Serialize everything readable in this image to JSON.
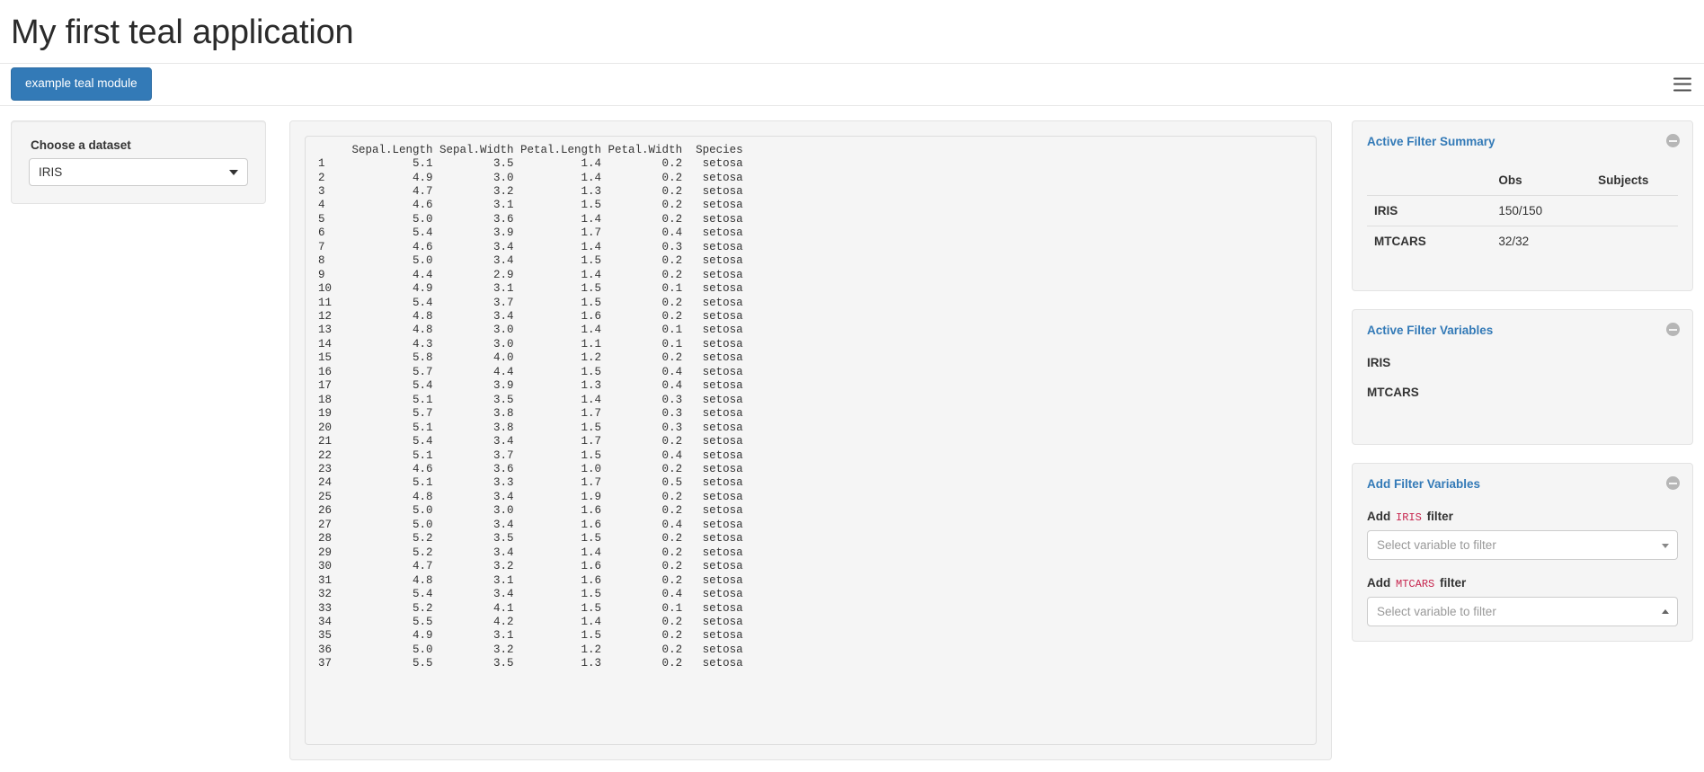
{
  "header": {
    "title": "My first teal application",
    "tab_label": "example teal module",
    "menu_icon": "hamburger-icon"
  },
  "sidebar": {
    "dataset_label": "Choose a dataset",
    "dataset_value": "IRIS",
    "caret_icon": "chevron-down-icon"
  },
  "table": {
    "columns": [
      "",
      "Sepal.Length",
      "Sepal.Width",
      "Petal.Length",
      "Petal.Width",
      "Species"
    ],
    "rows": [
      [
        "1",
        "5.1",
        "3.5",
        "1.4",
        "0.2",
        "setosa"
      ],
      [
        "2",
        "4.9",
        "3.0",
        "1.4",
        "0.2",
        "setosa"
      ],
      [
        "3",
        "4.7",
        "3.2",
        "1.3",
        "0.2",
        "setosa"
      ],
      [
        "4",
        "4.6",
        "3.1",
        "1.5",
        "0.2",
        "setosa"
      ],
      [
        "5",
        "5.0",
        "3.6",
        "1.4",
        "0.2",
        "setosa"
      ],
      [
        "6",
        "5.4",
        "3.9",
        "1.7",
        "0.4",
        "setosa"
      ],
      [
        "7",
        "4.6",
        "3.4",
        "1.4",
        "0.3",
        "setosa"
      ],
      [
        "8",
        "5.0",
        "3.4",
        "1.5",
        "0.2",
        "setosa"
      ],
      [
        "9",
        "4.4",
        "2.9",
        "1.4",
        "0.2",
        "setosa"
      ],
      [
        "10",
        "4.9",
        "3.1",
        "1.5",
        "0.1",
        "setosa"
      ],
      [
        "11",
        "5.4",
        "3.7",
        "1.5",
        "0.2",
        "setosa"
      ],
      [
        "12",
        "4.8",
        "3.4",
        "1.6",
        "0.2",
        "setosa"
      ],
      [
        "13",
        "4.8",
        "3.0",
        "1.4",
        "0.1",
        "setosa"
      ],
      [
        "14",
        "4.3",
        "3.0",
        "1.1",
        "0.1",
        "setosa"
      ],
      [
        "15",
        "5.8",
        "4.0",
        "1.2",
        "0.2",
        "setosa"
      ],
      [
        "16",
        "5.7",
        "4.4",
        "1.5",
        "0.4",
        "setosa"
      ],
      [
        "17",
        "5.4",
        "3.9",
        "1.3",
        "0.4",
        "setosa"
      ],
      [
        "18",
        "5.1",
        "3.5",
        "1.4",
        "0.3",
        "setosa"
      ],
      [
        "19",
        "5.7",
        "3.8",
        "1.7",
        "0.3",
        "setosa"
      ],
      [
        "20",
        "5.1",
        "3.8",
        "1.5",
        "0.3",
        "setosa"
      ],
      [
        "21",
        "5.4",
        "3.4",
        "1.7",
        "0.2",
        "setosa"
      ],
      [
        "22",
        "5.1",
        "3.7",
        "1.5",
        "0.4",
        "setosa"
      ],
      [
        "23",
        "4.6",
        "3.6",
        "1.0",
        "0.2",
        "setosa"
      ],
      [
        "24",
        "5.1",
        "3.3",
        "1.7",
        "0.5",
        "setosa"
      ],
      [
        "25",
        "4.8",
        "3.4",
        "1.9",
        "0.2",
        "setosa"
      ],
      [
        "26",
        "5.0",
        "3.0",
        "1.6",
        "0.2",
        "setosa"
      ],
      [
        "27",
        "5.0",
        "3.4",
        "1.6",
        "0.4",
        "setosa"
      ],
      [
        "28",
        "5.2",
        "3.5",
        "1.5",
        "0.2",
        "setosa"
      ],
      [
        "29",
        "5.2",
        "3.4",
        "1.4",
        "0.2",
        "setosa"
      ],
      [
        "30",
        "4.7",
        "3.2",
        "1.6",
        "0.2",
        "setosa"
      ],
      [
        "31",
        "4.8",
        "3.1",
        "1.6",
        "0.2",
        "setosa"
      ],
      [
        "32",
        "5.4",
        "3.4",
        "1.5",
        "0.4",
        "setosa"
      ],
      [
        "33",
        "5.2",
        "4.1",
        "1.5",
        "0.1",
        "setosa"
      ],
      [
        "34",
        "5.5",
        "4.2",
        "1.4",
        "0.2",
        "setosa"
      ],
      [
        "35",
        "4.9",
        "3.1",
        "1.5",
        "0.2",
        "setosa"
      ],
      [
        "36",
        "5.0",
        "3.2",
        "1.2",
        "0.2",
        "setosa"
      ],
      [
        "37",
        "5.5",
        "3.5",
        "1.3",
        "0.2",
        "setosa"
      ]
    ]
  },
  "filters": {
    "summary": {
      "title": "Active Filter Summary",
      "collapse_icon": "minus-circle-icon",
      "col_obs": "Obs",
      "col_subjects": "Subjects",
      "rows": [
        {
          "dataset": "IRIS",
          "obs": "150/150",
          "subjects": ""
        },
        {
          "dataset": "MTCARS",
          "obs": "32/32",
          "subjects": ""
        }
      ]
    },
    "active_vars": {
      "title": "Active Filter Variables",
      "collapse_icon": "minus-circle-icon",
      "items": [
        "IRIS",
        "MTCARS"
      ]
    },
    "add_vars": {
      "title": "Add Filter Variables",
      "collapse_icon": "minus-circle-icon",
      "iris": {
        "label_prefix": "Add",
        "dataset": "IRIS",
        "label_suffix": "filter",
        "placeholder": "Select variable to filter",
        "arrow_icon": "chevron-down-icon"
      },
      "mtcars": {
        "label_prefix": "Add",
        "dataset": "MTCARS",
        "label_suffix": "filter",
        "placeholder": "Select variable to filter",
        "arrow_icon": "chevron-up-icon"
      }
    }
  },
  "colors": {
    "brand_blue": "#337ab7",
    "panel_bg": "#f5f5f5",
    "code_red": "#c7254e"
  }
}
